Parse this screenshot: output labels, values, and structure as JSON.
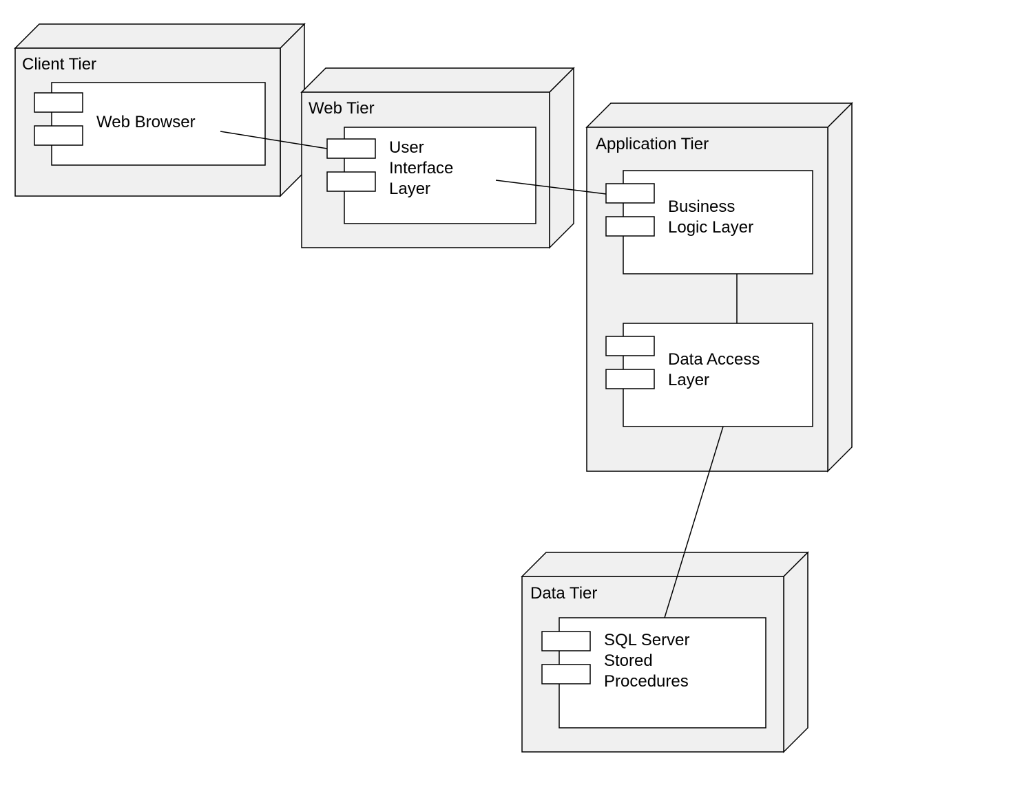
{
  "colors": {
    "nodeFill": "#f0f0f0",
    "componentFill": "#ffffff",
    "stroke": "#000000",
    "background": "#ffffff"
  },
  "nodes": {
    "client": {
      "title": "Client Tier",
      "components": {
        "webBrowser": {
          "label": "Web Browser"
        }
      }
    },
    "web": {
      "title": "Web Tier",
      "components": {
        "uiLayer": {
          "label": "User Interface Layer"
        }
      }
    },
    "application": {
      "title": "Application Tier",
      "components": {
        "bll": {
          "label": "Business Logic Layer"
        },
        "dal": {
          "label": "Data Access Layer"
        }
      }
    },
    "data": {
      "title": "Data Tier",
      "components": {
        "sqlSp": {
          "label": "SQL Server Stored Procedures"
        }
      }
    }
  },
  "edges": [
    {
      "from": "client.webBrowser",
      "to": "web.uiLayer"
    },
    {
      "from": "web.uiLayer",
      "to": "application.bll"
    },
    {
      "from": "application.bll",
      "to": "application.dal"
    },
    {
      "from": "application.dal",
      "to": "data.sqlSp"
    }
  ]
}
